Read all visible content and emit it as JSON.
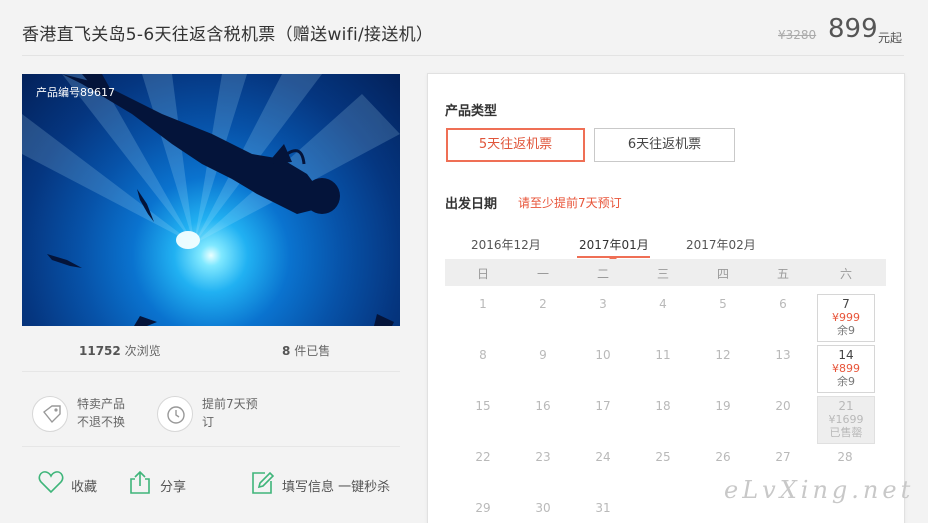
{
  "product": {
    "title": "香港直飞关岛5-6天往返含税机票（赠送wifi/接送机）",
    "original_price": "¥3280",
    "price": "899",
    "price_unit": "元起",
    "product_no": "产品编号89617"
  },
  "stats": {
    "views_count": "11752",
    "views_label": "次浏览",
    "sold_count": "8",
    "sold_label": "件已售"
  },
  "features": [
    {
      "icon": "tag-icon",
      "line1": "特卖产品",
      "line2": "不退不换"
    },
    {
      "icon": "clock-icon",
      "line1": "提前7天预",
      "line2": "订"
    }
  ],
  "actions": {
    "favorite": "收藏",
    "share": "分享",
    "fill_info": "填写信息 一键秒杀"
  },
  "booking": {
    "type_label": "产品类型",
    "options": [
      "5天往返机票",
      "6天往返机票"
    ],
    "selected_option": "5天往返机票",
    "date_label": "出发日期",
    "date_hint": "请至少提前7天预订",
    "months": [
      "2016年12月",
      "2017年01月",
      "2017年02月"
    ],
    "active_month": "2017年01月",
    "weekdays": [
      "日",
      "一",
      "二",
      "三",
      "四",
      "五",
      "六"
    ],
    "days": [
      "1",
      "2",
      "3",
      "4",
      "5",
      "6",
      "7",
      "8",
      "9",
      "10",
      "11",
      "12",
      "13",
      "14",
      "15",
      "16",
      "17",
      "18",
      "19",
      "20",
      "21",
      "22",
      "23",
      "24",
      "25",
      "26",
      "27",
      "28",
      "29",
      "30",
      "31"
    ],
    "available": [
      {
        "day": "7",
        "price": "¥999",
        "status": "余9"
      },
      {
        "day": "14",
        "price": "¥899",
        "status": "余9"
      },
      {
        "day": "21",
        "price": "¥1699",
        "status": "已售罄"
      }
    ]
  },
  "watermark": "eLvXing.net",
  "colors": {
    "accent": "#ef6f55",
    "accent_text": "#e8553a",
    "green_icon": "#3fb57a"
  }
}
